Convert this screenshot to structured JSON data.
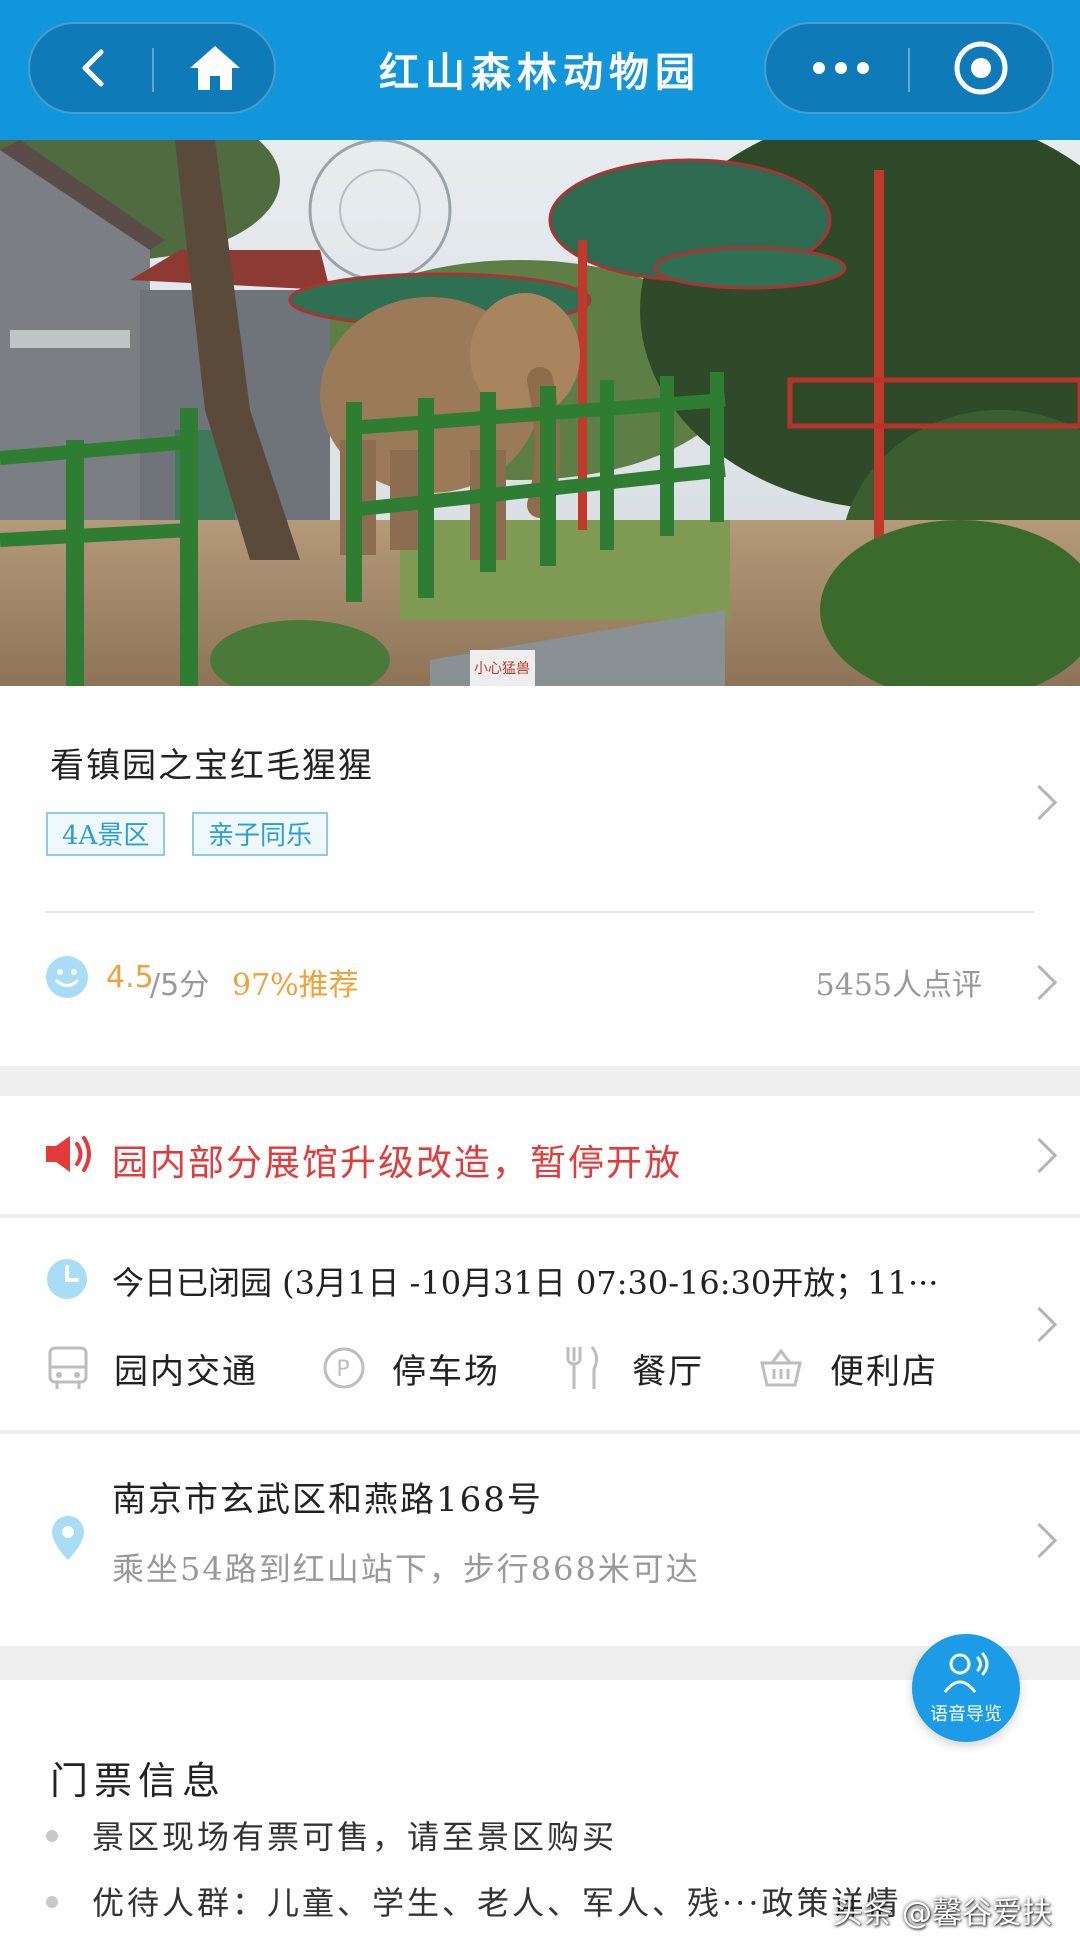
{
  "header": {
    "title": "红山森林动物园"
  },
  "hero": {
    "sign_text": "小心猛兽"
  },
  "info": {
    "title": "看镇园之宝红毛猩猩",
    "tags": [
      "4A景区",
      "亲子同乐"
    ],
    "rating": {
      "score": "4.5",
      "score_suffix": "/5分",
      "recommend": "97%推荐",
      "reviews": "5455人点评"
    }
  },
  "notice": {
    "text": "园内部分展馆升级改造，暂停开放"
  },
  "hours": {
    "text": "今日已闭园 (3月1日 -10月31日  07:30-16:30开放；11···",
    "facilities": [
      {
        "label": "园内交通",
        "icon": "bus-icon"
      },
      {
        "label": "停车场",
        "icon": "parking-icon"
      },
      {
        "label": "餐厅",
        "icon": "restaurant-icon"
      },
      {
        "label": "便利店",
        "icon": "store-icon"
      }
    ]
  },
  "address": {
    "line": "南京市玄武区和燕路168号",
    "route": "乘坐54路到红山站下，步行868米可达"
  },
  "tickets": {
    "title": "门票信息",
    "lines": [
      "景区现场有票可售，请至景区购买",
      "优待人群：儿童、学生、老人、军人、残···政策详情"
    ]
  },
  "voice_guide": {
    "label": "语音导览"
  },
  "watermark": "头条 @馨谷爱扶",
  "colors": {
    "header_bg": "#1296db",
    "accent_orange": "#f0a23a",
    "notice_red": "#e33b3b",
    "tag_blue": "#2a9fd6"
  }
}
